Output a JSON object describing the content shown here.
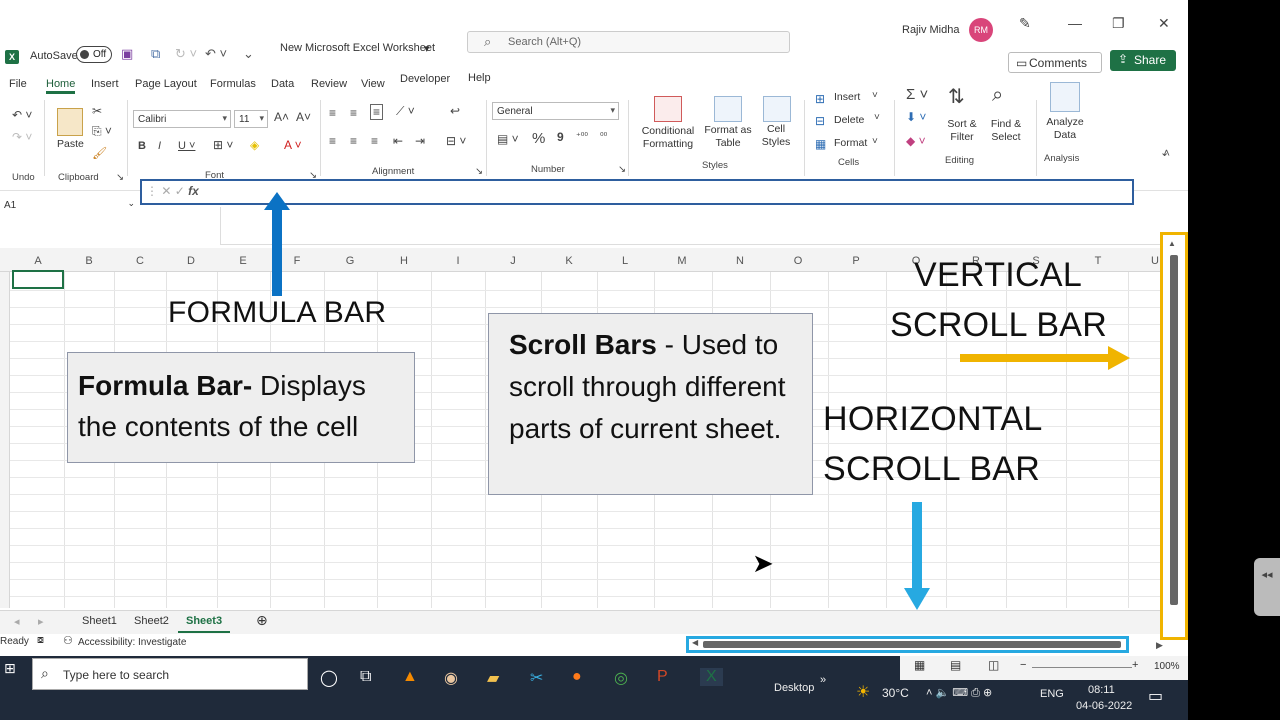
{
  "app": {
    "autosave_label": "AutoSave",
    "autosave_state": "Off",
    "doc_title": "New Microsoft Excel Worksheet",
    "search_placeholder": "Search (Alt+Q)",
    "user_name": "Rajiv Midha",
    "user_initials": "RM"
  },
  "ribbon_tabs": [
    "File",
    "Home",
    "Insert",
    "Page Layout",
    "Formulas",
    "Data",
    "Review",
    "View",
    "Developer",
    "Help"
  ],
  "comments_label": "Comments",
  "share_label": "Share",
  "ribbon": {
    "undo_group": "Undo",
    "clipboard_group": "Clipboard",
    "paste_label": "Paste",
    "font_group": "Font",
    "font_name": "Calibri",
    "font_size": "11",
    "alignment_group": "Alignment",
    "number_group": "Number",
    "number_format": "General",
    "styles_group": "Styles",
    "conditional_formatting": "Conditional Formatting",
    "format_as_table": "Format as Table",
    "cell_styles": "Cell Styles",
    "cells_group": "Cells",
    "insert_label": "Insert",
    "delete_label": "Delete",
    "format_label": "Format",
    "editing_group": "Editing",
    "sort_filter": "Sort & Filter",
    "find_select": "Find & Select",
    "analysis_group": "Analysis",
    "analyze_data": "Analyze Data"
  },
  "formula_bar": {
    "name_box": "A1",
    "fx": "fx"
  },
  "columns": [
    "A",
    "B",
    "C",
    "D",
    "E",
    "F",
    "G",
    "H",
    "I",
    "J",
    "K",
    "L",
    "M",
    "N",
    "O",
    "P",
    "Q",
    "R",
    "S",
    "T",
    "U"
  ],
  "annotations": {
    "formula_bar_label": "FORMULA BAR",
    "formula_box_bold": "Formula Bar-",
    "formula_box_text": " Displays the contents of the cell",
    "scroll_box_bold": "Scroll Bars",
    "scroll_box_text": " - Used to scroll through different parts of current sheet.",
    "vertical_line1": "VERTICAL",
    "vertical_line2": "SCROLL BAR",
    "horizontal_line1": "HORIZONTAL",
    "horizontal_line2": "SCROLL BAR",
    "arrow_blue": "#0b72c4",
    "arrow_cyan": "#27a9e1",
    "arrow_gold": "#f0b400"
  },
  "sheet_tabs": [
    "Sheet1",
    "Sheet2",
    "Sheet3"
  ],
  "active_sheet": "Sheet3",
  "status": {
    "ready": "Ready",
    "accessibility": "Accessibility: Investigate",
    "zoom": "100%"
  },
  "taskbar": {
    "search_placeholder": "Type here to search",
    "desktop_label": "Desktop",
    "temperature": "30°C",
    "language": "ENG",
    "time": "08:11",
    "date": "04-06-2022"
  }
}
